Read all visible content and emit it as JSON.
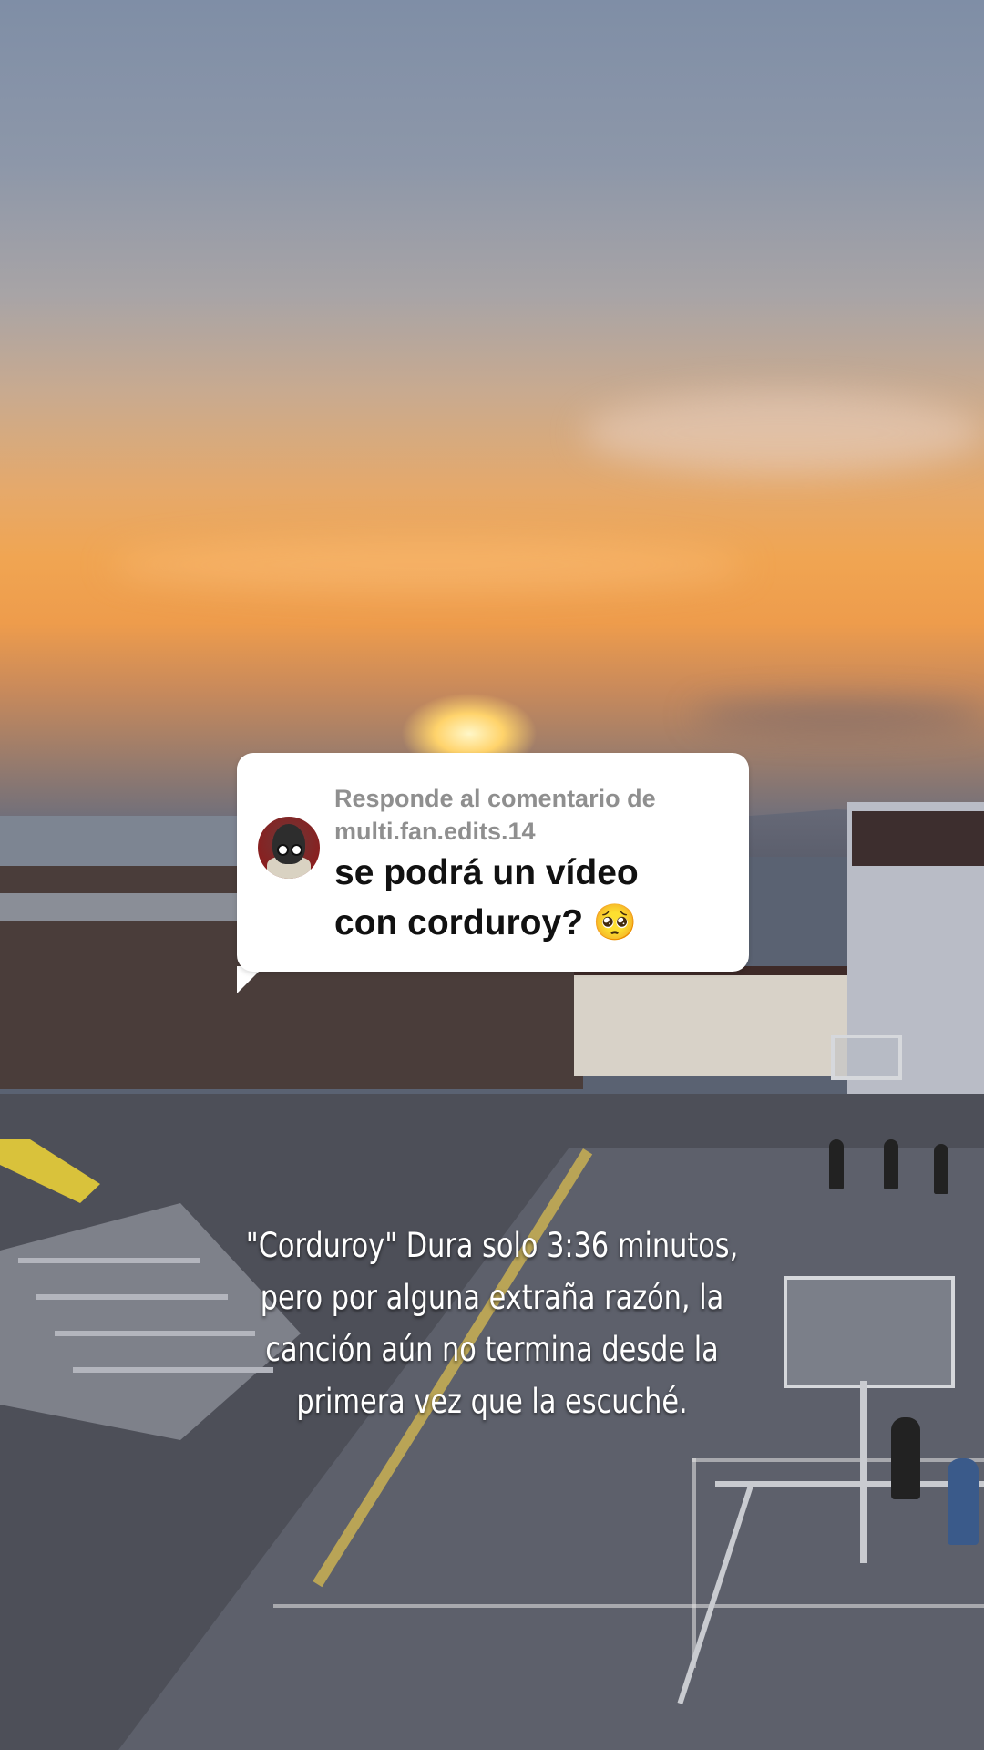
{
  "reply": {
    "label_line1": "Responde al comentario de",
    "label_line2": "multi.fan.edits.14",
    "comment_line1": "se podrá un vídeo",
    "comment_line2": "con corduroy? 🥺"
  },
  "caption": {
    "line1": "\"Corduroy\" Dura solo 3:36 minutos,",
    "line2": "pero por alguna extraña razón, la",
    "line3": "canción aún no termina desde la",
    "line4": "primera vez que la escuché."
  },
  "colors": {
    "card_bg": "#ffffff",
    "label_text": "#8f8f8f",
    "comment_text": "#111111",
    "caption_text": "#ffffff"
  },
  "icons": {
    "avatar": "commenter-avatar"
  }
}
